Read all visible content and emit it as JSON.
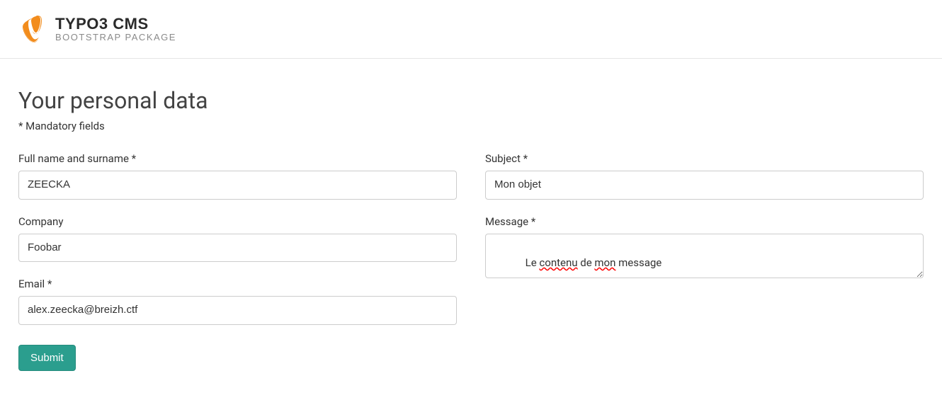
{
  "brand": {
    "title": "TYPO3 CMS",
    "subtitle": "BOOTSTRAP PACKAGE"
  },
  "page": {
    "heading": "Your personal data",
    "mandatory_note": "* Mandatory fields"
  },
  "form": {
    "fullname": {
      "label": "Full name and surname *",
      "value": "ZEECKA"
    },
    "company": {
      "label": "Company",
      "value": "Foobar"
    },
    "email": {
      "label": "Email *",
      "value": "alex.zeecka@breizh.ctf"
    },
    "subject": {
      "label": "Subject *",
      "value": "Mon objet"
    },
    "message": {
      "label": "Message *",
      "value": "Le contenu de mon message",
      "parts": [
        "Le ",
        "contenu",
        " de ",
        "mon",
        " message"
      ]
    },
    "submit_label": "Submit"
  }
}
